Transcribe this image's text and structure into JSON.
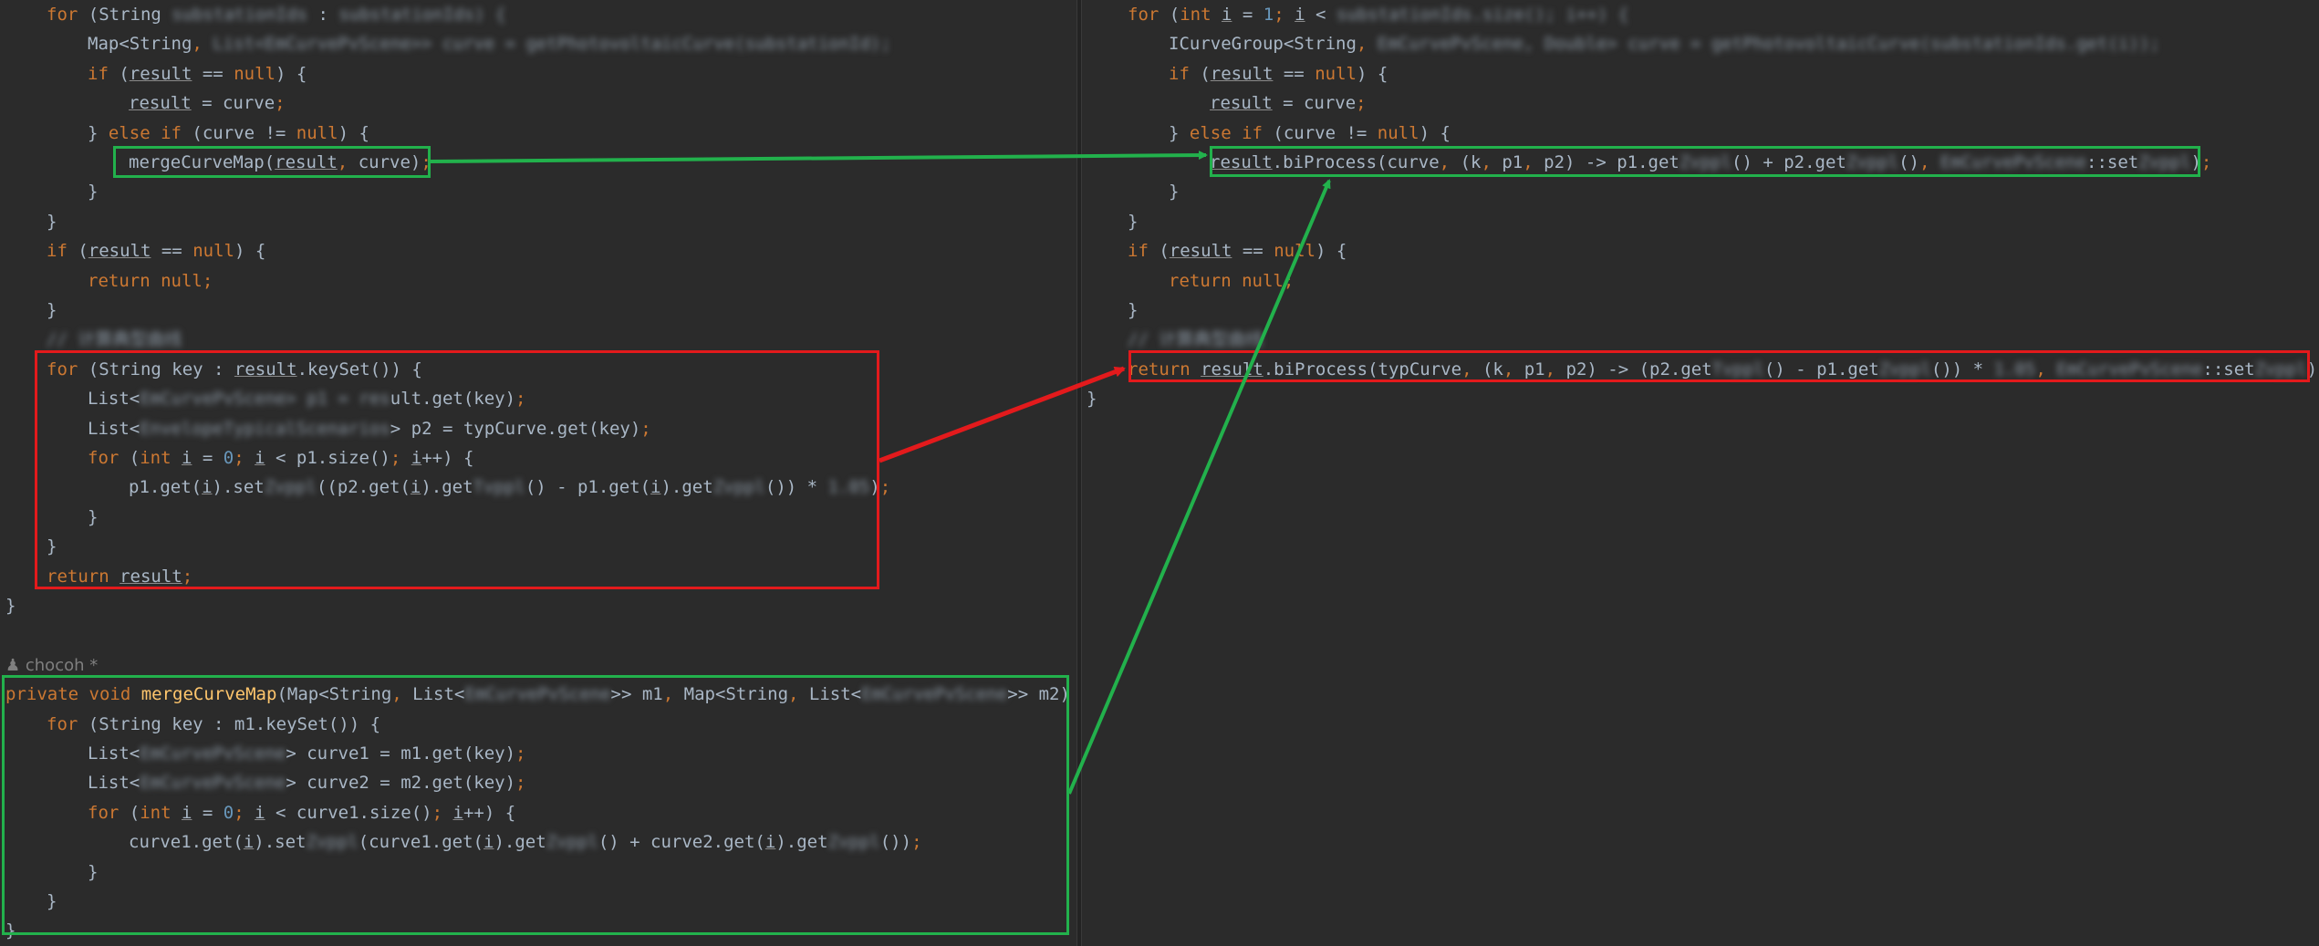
{
  "left_code": [
    {
      "indent": 1,
      "tokens": [
        [
          "kw",
          "for "
        ],
        [
          "pl",
          "(String "
        ],
        [
          "blur",
          "substationIds"
        ],
        [
          "pl",
          " : "
        ],
        [
          "blur",
          "substationIds) {"
        ]
      ]
    },
    {
      "indent": 2,
      "tokens": [
        [
          "pl",
          "Map<String"
        ],
        [
          "kw",
          ", "
        ],
        [
          "blur",
          "List<EmCurvePvScene>> curve = getPhotovoltaicCurve(substationId);"
        ]
      ]
    },
    {
      "indent": 2,
      "tokens": [
        [
          "kw",
          "if "
        ],
        [
          "pl",
          "("
        ],
        [
          "ul",
          "result"
        ],
        [
          "pl",
          " == "
        ],
        [
          "kw",
          "null"
        ],
        [
          "pl",
          ") {"
        ]
      ]
    },
    {
      "indent": 3,
      "tokens": [
        [
          "ul",
          "result"
        ],
        [
          "pl",
          " = curve"
        ],
        [
          "kw",
          ";"
        ]
      ]
    },
    {
      "indent": 2,
      "tokens": [
        [
          "pl",
          "} "
        ],
        [
          "kw",
          "else if "
        ],
        [
          "pl",
          "(curve != "
        ],
        [
          "kw",
          "null"
        ],
        [
          "pl",
          ") {"
        ]
      ]
    },
    {
      "indent": 3,
      "tokens": [
        [
          "pl",
          "mergeCurveMap("
        ],
        [
          "ul",
          "result"
        ],
        [
          "kw",
          ", "
        ],
        [
          "pl",
          "curve)"
        ],
        [
          "kw",
          ";"
        ]
      ]
    },
    {
      "indent": 2,
      "tokens": [
        [
          "pl",
          "}"
        ]
      ]
    },
    {
      "indent": 1,
      "tokens": [
        [
          "pl",
          "}"
        ]
      ]
    },
    {
      "indent": 1,
      "tokens": [
        [
          "kw",
          "if "
        ],
        [
          "pl",
          "("
        ],
        [
          "ul",
          "result"
        ],
        [
          "pl",
          " == "
        ],
        [
          "kw",
          "null"
        ],
        [
          "pl",
          ") {"
        ]
      ]
    },
    {
      "indent": 2,
      "tokens": [
        [
          "kw",
          "return null;"
        ]
      ]
    },
    {
      "indent": 1,
      "tokens": [
        [
          "pl",
          "}"
        ]
      ]
    },
    {
      "indent": 1,
      "tokens": [
        [
          "blur",
          "// 计算典型曲线"
        ]
      ]
    },
    {
      "indent": 1,
      "tokens": [
        [
          "kw",
          "for "
        ],
        [
          "pl",
          "(String key : "
        ],
        [
          "ul",
          "result"
        ],
        [
          "pl",
          ".keySet()) {"
        ]
      ]
    },
    {
      "indent": 2,
      "tokens": [
        [
          "pl",
          "List<"
        ],
        [
          "blur",
          "EmCurvePvScene> p1 = res"
        ],
        [
          "pl",
          "ult.get(key)"
        ],
        [
          "kw",
          ";"
        ]
      ]
    },
    {
      "indent": 2,
      "tokens": [
        [
          "pl",
          "List<"
        ],
        [
          "blur",
          "EnvelopeTypicalScenarios"
        ],
        [
          "pl",
          "> p2 = typCurve.get(key)"
        ],
        [
          "kw",
          ";"
        ]
      ]
    },
    {
      "indent": 2,
      "tokens": [
        [
          "kw",
          "for "
        ],
        [
          "pl",
          "("
        ],
        [
          "kw",
          "int "
        ],
        [
          "ul",
          "i"
        ],
        [
          "pl",
          " = "
        ],
        [
          "num",
          "0"
        ],
        [
          "kw",
          "; "
        ],
        [
          "ul",
          "i"
        ],
        [
          "pl",
          " < p1.size()"
        ],
        [
          "kw",
          "; "
        ],
        [
          "ul",
          "i"
        ],
        [
          "pl",
          "++) {"
        ]
      ]
    },
    {
      "indent": 3,
      "tokens": [
        [
          "pl",
          "p1.get("
        ],
        [
          "ul",
          "i"
        ],
        [
          "pl",
          ").set"
        ],
        [
          "blur",
          "Zvppl"
        ],
        [
          "pl",
          "((p2.get("
        ],
        [
          "ul",
          "i"
        ],
        [
          "pl",
          ").get"
        ],
        [
          "blur",
          "Tvppl"
        ],
        [
          "pl",
          "() - p1.get("
        ],
        [
          "ul",
          "i"
        ],
        [
          "pl",
          ").get"
        ],
        [
          "blur",
          "Zvppl"
        ],
        [
          "pl",
          "()) * "
        ],
        [
          "blur",
          "1.05"
        ],
        [
          "pl",
          ")"
        ],
        [
          "kw",
          ";"
        ]
      ]
    },
    {
      "indent": 2,
      "tokens": [
        [
          "pl",
          "}"
        ]
      ]
    },
    {
      "indent": 1,
      "tokens": [
        [
          "pl",
          "}"
        ]
      ]
    },
    {
      "indent": 1,
      "tokens": [
        [
          "kw",
          "return "
        ],
        [
          "ul",
          "result"
        ],
        [
          "kw",
          ";"
        ]
      ]
    },
    {
      "indent": 0,
      "tokens": [
        [
          "pl",
          "}"
        ]
      ]
    },
    {
      "indent": 0,
      "tokens": []
    },
    {
      "indent": 0,
      "tokens": []
    },
    {
      "indent": 0,
      "tokens": [
        [
          "kw",
          "private void "
        ],
        [
          "fn",
          "mergeCurveMap"
        ],
        [
          "pl",
          "(Map<String"
        ],
        [
          "kw",
          ", "
        ],
        [
          "pl",
          "List<"
        ],
        [
          "blur",
          "EmCurvePvScene"
        ],
        [
          "pl",
          ">> m1"
        ],
        [
          "kw",
          ", "
        ],
        [
          "pl",
          "Map<String"
        ],
        [
          "kw",
          ", "
        ],
        [
          "pl",
          "List<"
        ],
        [
          "blur",
          "EmCurvePvScene"
        ],
        [
          "pl",
          ">> m2) {"
        ]
      ]
    },
    {
      "indent": 1,
      "tokens": [
        [
          "kw",
          "for "
        ],
        [
          "pl",
          "(String key : m1.keySet()) {"
        ]
      ]
    },
    {
      "indent": 2,
      "tokens": [
        [
          "pl",
          "List<"
        ],
        [
          "blur",
          "EmCurvePvScene"
        ],
        [
          "pl",
          "> curve1 = m1.get(key)"
        ],
        [
          "kw",
          ";"
        ]
      ]
    },
    {
      "indent": 2,
      "tokens": [
        [
          "pl",
          "List<"
        ],
        [
          "blur",
          "EmCurvePvScene"
        ],
        [
          "pl",
          "> curve2 = m2.get(key)"
        ],
        [
          "kw",
          ";"
        ]
      ]
    },
    {
      "indent": 2,
      "tokens": [
        [
          "kw",
          "for "
        ],
        [
          "pl",
          "("
        ],
        [
          "kw",
          "int "
        ],
        [
          "ul",
          "i"
        ],
        [
          "pl",
          " = "
        ],
        [
          "num",
          "0"
        ],
        [
          "kw",
          "; "
        ],
        [
          "ul",
          "i"
        ],
        [
          "pl",
          " < curve1.size()"
        ],
        [
          "kw",
          "; "
        ],
        [
          "ul",
          "i"
        ],
        [
          "pl",
          "++) {"
        ]
      ]
    },
    {
      "indent": 3,
      "tokens": [
        [
          "pl",
          "curve1.get("
        ],
        [
          "ul",
          "i"
        ],
        [
          "pl",
          ").set"
        ],
        [
          "blur",
          "Zvppl"
        ],
        [
          "pl",
          "(curve1.get("
        ],
        [
          "ul",
          "i"
        ],
        [
          "pl",
          ").get"
        ],
        [
          "blur",
          "Zvppl"
        ],
        [
          "pl",
          "() + curve2.get("
        ],
        [
          "ul",
          "i"
        ],
        [
          "pl",
          ").get"
        ],
        [
          "blur",
          "Zvppl"
        ],
        [
          "pl",
          "())"
        ],
        [
          "kw",
          ";"
        ]
      ]
    },
    {
      "indent": 2,
      "tokens": [
        [
          "pl",
          "}"
        ]
      ]
    },
    {
      "indent": 1,
      "tokens": [
        [
          "pl",
          "}"
        ]
      ]
    },
    {
      "indent": 0,
      "tokens": [
        [
          "pl",
          "}"
        ]
      ]
    }
  ],
  "right_code": [
    {
      "indent": 1,
      "tokens": [
        [
          "kw",
          "for "
        ],
        [
          "pl",
          "("
        ],
        [
          "kw",
          "int "
        ],
        [
          "ul",
          "i"
        ],
        [
          "pl",
          " = "
        ],
        [
          "num",
          "1"
        ],
        [
          "kw",
          "; "
        ],
        [
          "ul",
          "i"
        ],
        [
          "pl",
          " < "
        ],
        [
          "blur",
          "substationIds.size(); i++) {"
        ]
      ]
    },
    {
      "indent": 2,
      "tokens": [
        [
          "pl",
          "ICurveGroup<String"
        ],
        [
          "kw",
          ", "
        ],
        [
          "blur",
          "EmCurvePvScene, Double> curve = getPhotovoltaicCurve(substationIds.get(i));"
        ]
      ]
    },
    {
      "indent": 2,
      "tokens": [
        [
          "kw",
          "if "
        ],
        [
          "pl",
          "("
        ],
        [
          "ul",
          "result"
        ],
        [
          "pl",
          " == "
        ],
        [
          "kw",
          "null"
        ],
        [
          "pl",
          ") {"
        ]
      ]
    },
    {
      "indent": 3,
      "tokens": [
        [
          "ul",
          "result"
        ],
        [
          "pl",
          " = curve"
        ],
        [
          "kw",
          ";"
        ]
      ]
    },
    {
      "indent": 2,
      "tokens": [
        [
          "pl",
          "} "
        ],
        [
          "kw",
          "else if "
        ],
        [
          "pl",
          "(curve != "
        ],
        [
          "kw",
          "null"
        ],
        [
          "pl",
          ") {"
        ]
      ]
    },
    {
      "indent": 3,
      "tokens": [
        [
          "ul",
          "result"
        ],
        [
          "pl",
          ".biProcess(curve"
        ],
        [
          "kw",
          ", "
        ],
        [
          "pl",
          "(k"
        ],
        [
          "kw",
          ", "
        ],
        [
          "pl",
          "p1"
        ],
        [
          "kw",
          ", "
        ],
        [
          "pl",
          "p2) -> p1.get"
        ],
        [
          "blur",
          "Zvppl"
        ],
        [
          "pl",
          "() + p2.get"
        ],
        [
          "blur",
          "Zvppl"
        ],
        [
          "pl",
          "()"
        ],
        [
          "kw",
          ", "
        ],
        [
          "blur",
          "EmCurvePvScene"
        ],
        [
          "pl",
          "::set"
        ],
        [
          "blur",
          "Zvppl"
        ],
        [
          "pl",
          ")"
        ],
        [
          "kw",
          ";"
        ]
      ]
    },
    {
      "indent": 2,
      "tokens": [
        [
          "pl",
          "}"
        ]
      ]
    },
    {
      "indent": 1,
      "tokens": [
        [
          "pl",
          "}"
        ]
      ]
    },
    {
      "indent": 1,
      "tokens": [
        [
          "kw",
          "if "
        ],
        [
          "pl",
          "("
        ],
        [
          "ul",
          "result"
        ],
        [
          "pl",
          " == "
        ],
        [
          "kw",
          "null"
        ],
        [
          "pl",
          ") {"
        ]
      ]
    },
    {
      "indent": 2,
      "tokens": [
        [
          "kw",
          "return null;"
        ]
      ]
    },
    {
      "indent": 1,
      "tokens": [
        [
          "pl",
          "}"
        ]
      ]
    },
    {
      "indent": 1,
      "tokens": [
        [
          "blur",
          "// 计算典型曲线"
        ]
      ]
    },
    {
      "indent": 1,
      "tokens": [
        [
          "kw",
          "return "
        ],
        [
          "ul",
          "result"
        ],
        [
          "pl",
          ".biProcess(typCurve"
        ],
        [
          "kw",
          ", "
        ],
        [
          "pl",
          "(k"
        ],
        [
          "kw",
          ", "
        ],
        [
          "pl",
          "p1"
        ],
        [
          "kw",
          ", "
        ],
        [
          "pl",
          "p2) -> (p2.get"
        ],
        [
          "blur",
          "Tvppl"
        ],
        [
          "pl",
          "() - p1.get"
        ],
        [
          "blur",
          "Zvppl"
        ],
        [
          "pl",
          "()) * "
        ],
        [
          "blur",
          "1.05"
        ],
        [
          "kw",
          ", "
        ],
        [
          "blur",
          "EmCurvePvScene"
        ],
        [
          "pl",
          "::set"
        ],
        [
          "blur",
          "Zvppl"
        ],
        [
          "pl",
          ")"
        ],
        [
          "kw",
          ";"
        ]
      ]
    },
    {
      "indent": 0,
      "tokens": [
        [
          "pl",
          "}"
        ]
      ]
    }
  ],
  "author_hint": "chocoh *",
  "colors": {
    "background": "#2b2b2b",
    "keyword": "#cc7832",
    "number": "#6897bb",
    "method": "#ffc66d",
    "text": "#a9b7c6",
    "highlight_green": "#22b14c",
    "highlight_red": "#e31a1c"
  }
}
